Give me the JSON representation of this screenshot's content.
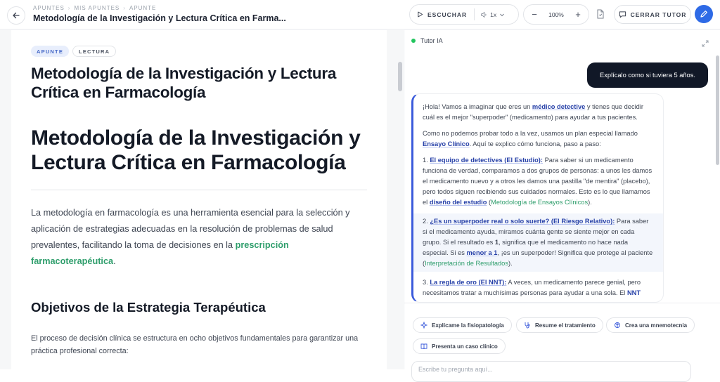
{
  "header": {
    "breadcrumbs": [
      "APUNTES",
      "MIS APUNTES",
      "APUNTE"
    ],
    "title": "Metodología de la Investigación y Lectura Crítica en Farma...",
    "listen_label": "ESCUCHAR",
    "speed": "1x",
    "zoom": "100%",
    "close_tutor_label": "CERRAR TUTOR"
  },
  "document": {
    "tags": [
      "APUNTE",
      "LECTURA"
    ],
    "title": "Metodología de la Investigación y Lectura Crítica en Farmacología",
    "heading1": "Metodología de la Investigación y Lectura Crítica en Farmacología",
    "intro_before": "La metodología en farmacología es una herramienta esencial para la selección y aplicación de estrategias adecuadas en la resolución de problemas de salud prevalentes, facilitando la toma de decisiones en la ",
    "intro_highlight": "prescripción farmacoterapéutica",
    "intro_after": ".",
    "heading2": "Objetivos de la Estrategia Terapéutica",
    "paragraph": "El proceso de decisión clínica se estructura en ocho objetivos fundamentales para garantizar una práctica profesional correcta:"
  },
  "tutor": {
    "title": "Tutor IA",
    "user_message": "Explícalo como si tuviera 5 años.",
    "ai": {
      "p1_a": "¡Hola! Vamos a imaginar que eres un ",
      "p1_kw": "médico detective",
      "p1_b": " y tienes que decidir cuál es el mejor \"superpoder\" (medicamento) para ayudar a tus pacientes.",
      "p2_a": "Como no podemos probar todo a la vez, usamos un plan especial llamado ",
      "p2_kw": "Ensayo Clínico",
      "p2_b": ". Aquí te explico cómo funciona, paso a paso:",
      "p3_num": "1. ",
      "p3_kw": "El equipo de detectives (El Estudio):",
      "p3_a": " Para saber si un medicamento funciona de verdad, comparamos a dos grupos de personas: a unos les damos el medicamento nuevo y a otros les damos una pastilla \"de mentira\" (placebo), pero todos siguen recibiendo sus cuidados normales. Esto es lo que llamamos el ",
      "p3_kw2": "diseño del estudio",
      "p3_b": " (",
      "p3_gr": "Metodología de Ensayos Clínicos",
      "p3_c": ").",
      "p4_num": "2. ",
      "p4_kw": "¿Es un superpoder real o solo suerte? (El Riesgo Relativo):",
      "p4_a": " Para saber si el medicamento ayuda, miramos cuánta gente se siente mejor en cada grupo. Si el resultado es ",
      "p4_b1": "1",
      "p4_b": ", significa que el medicamento no hace nada especial. Si es ",
      "p4_kw2": "menor a 1",
      "p4_c": ", ¡es un superpoder! Significa que protege al paciente (",
      "p4_gr": "Interpretación de Resultados",
      "p4_d": ").",
      "p5_num": "3. ",
      "p5_kw": "La regla de oro (El NNT):",
      "p5_a": " A veces, un medicamento parece genial, pero necesitamos tratar a muchísimas personas para ayudar a una sola. El ",
      "p5_kw2": "NNT"
    },
    "suggestions": [
      "Explícame la fisiopatología",
      "Resume el tratamiento",
      "Crea una mnemotecnia",
      "Presenta un caso clínico"
    ],
    "input_placeholder": "Escribe tu pregunta aquí..."
  }
}
